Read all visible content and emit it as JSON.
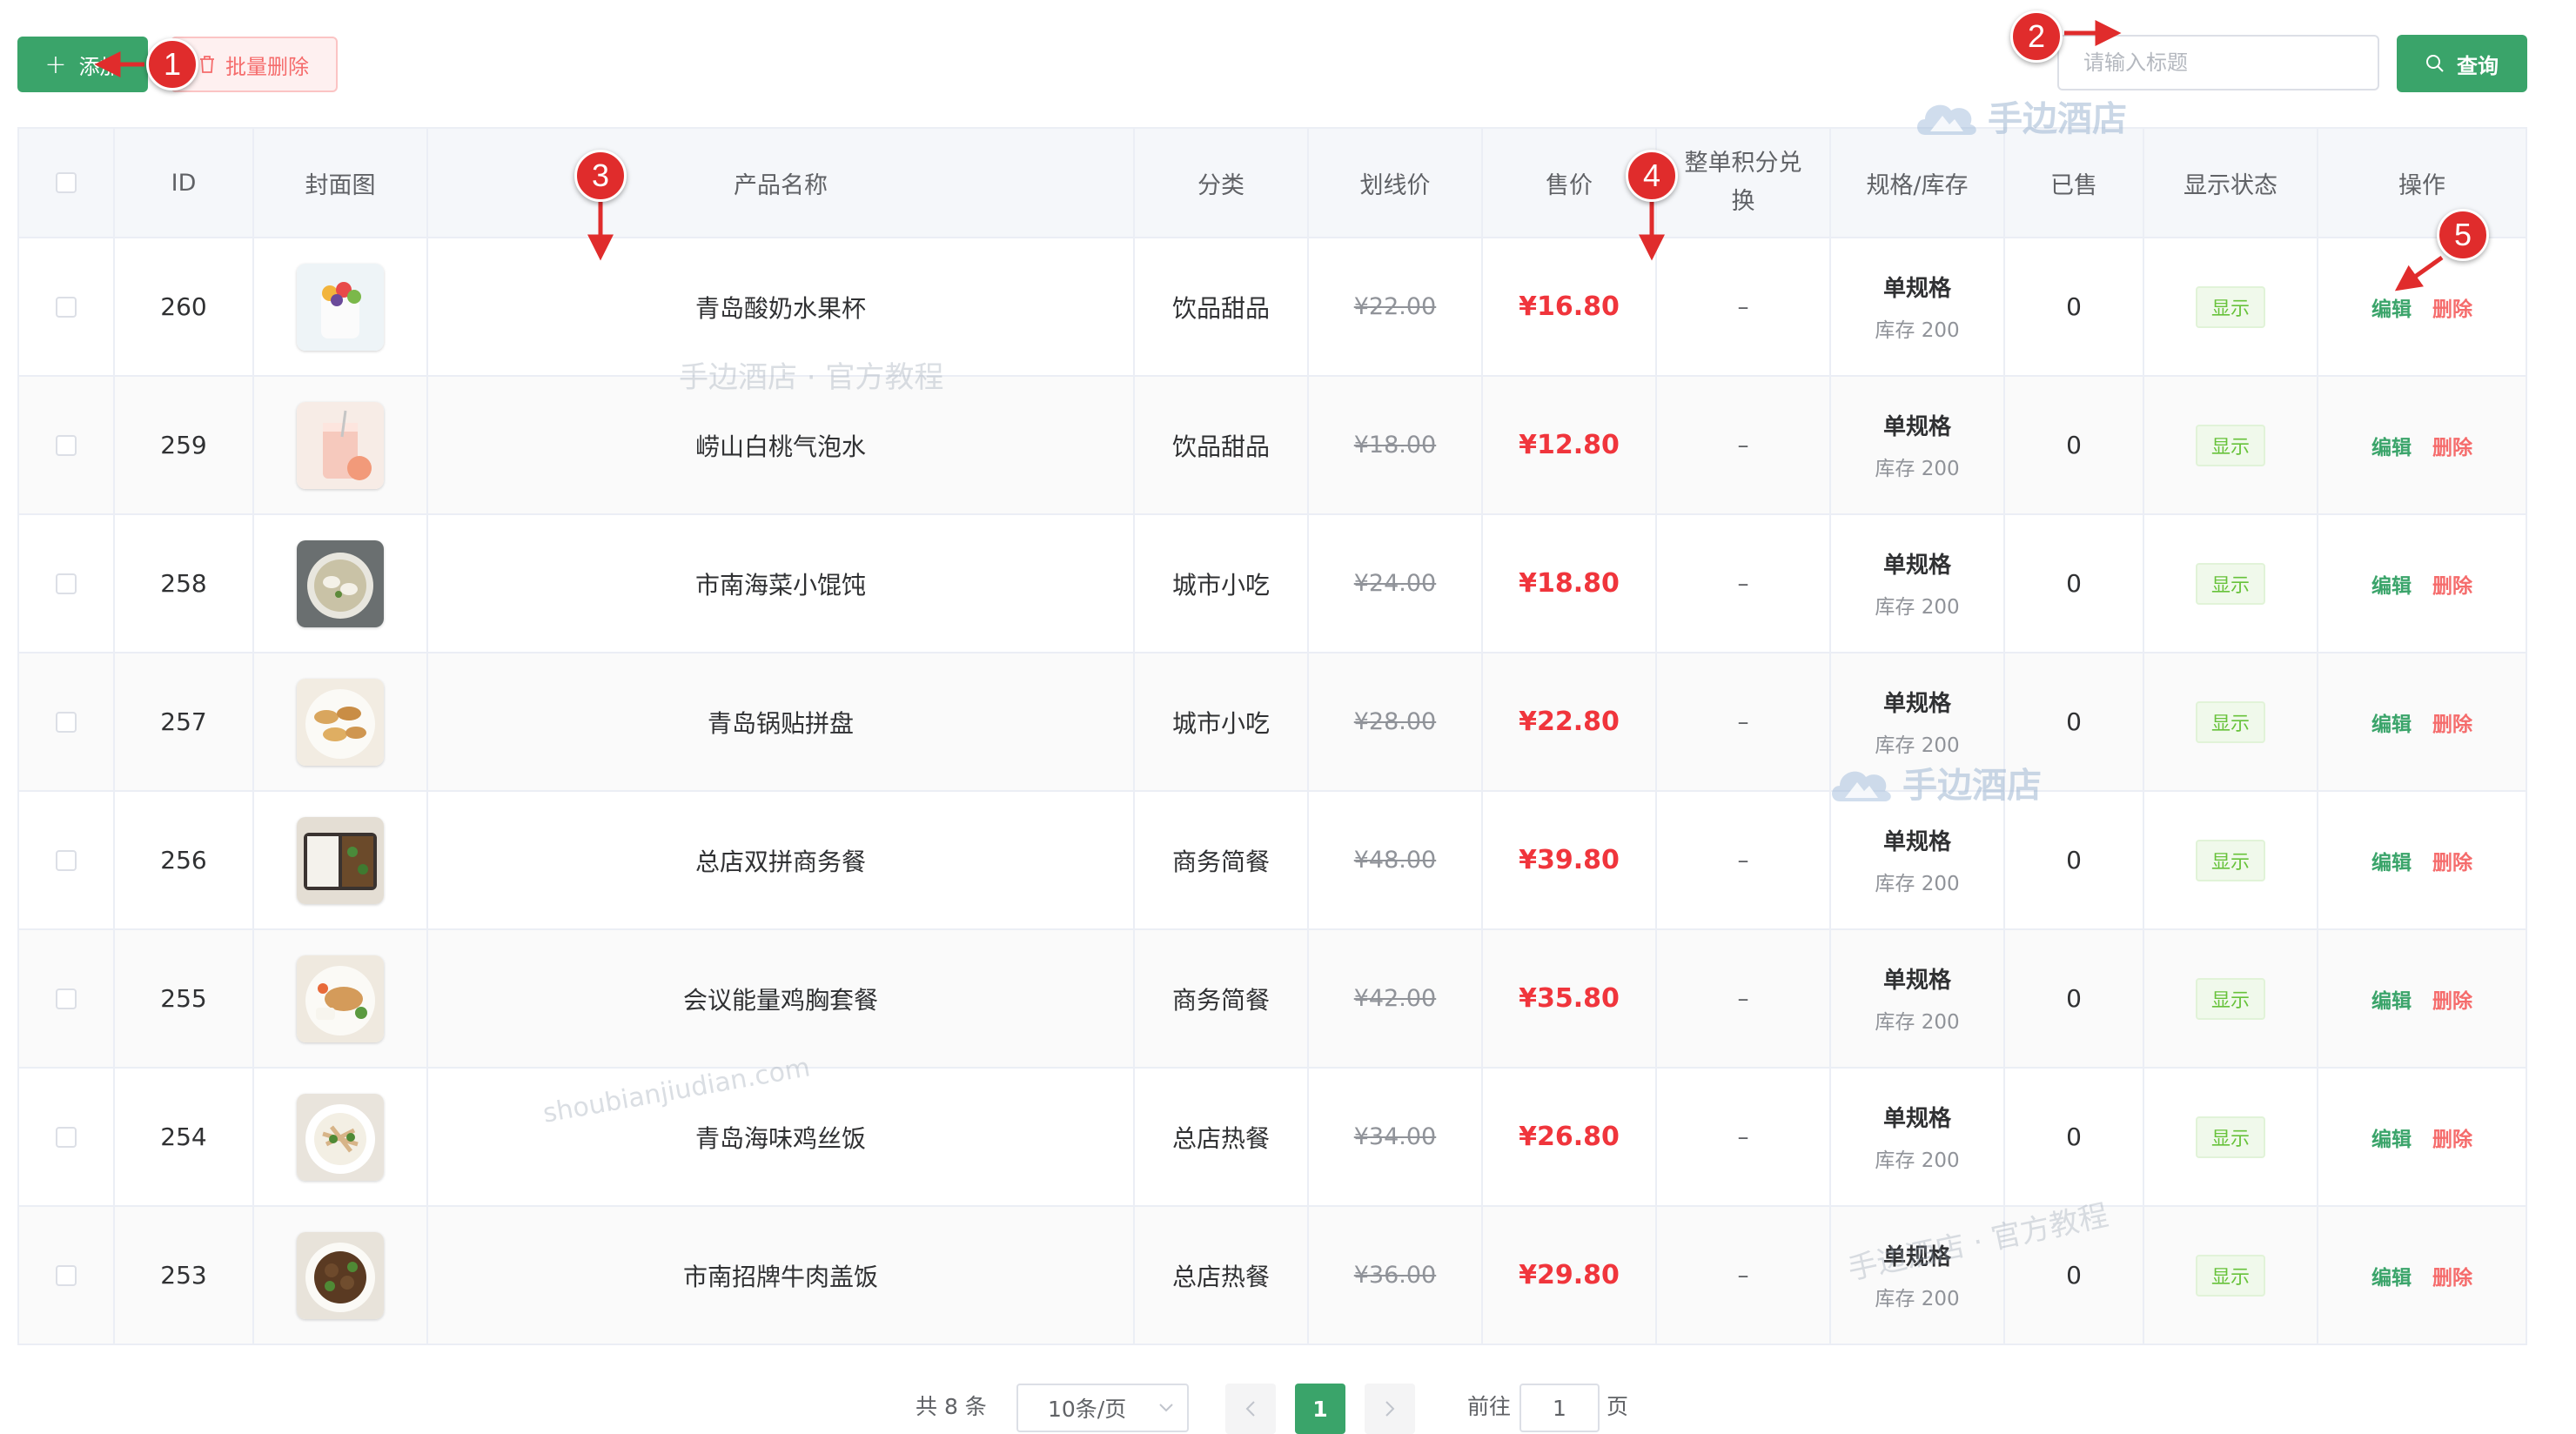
{
  "toolbar": {
    "add_label": "添加",
    "batch_delete_label": "批量删除",
    "search_placeholder": "请输入标题",
    "search_value": "",
    "query_label": "查询"
  },
  "table": {
    "headers": [
      "ID",
      "封面图",
      "产品名称",
      "分类",
      "划线价",
      "售价",
      "整单积分兑换",
      "规格/库存",
      "已售",
      "显示状态",
      "操作"
    ],
    "rows": [
      {
        "id": "260",
        "name": "青岛酸奶水果杯",
        "category": "饮品甜品",
        "orig_price": "¥22.00",
        "price": "¥16.80",
        "points": "–",
        "spec": "单规格",
        "stock": "库存 200",
        "sold": "0",
        "status": "显示",
        "edit": "编辑",
        "delete": "删除",
        "thumb_icon": "yogurt-fruit-cup"
      },
      {
        "id": "259",
        "name": "崂山白桃气泡水",
        "category": "饮品甜品",
        "orig_price": "¥18.00",
        "price": "¥12.80",
        "points": "–",
        "spec": "单规格",
        "stock": "库存 200",
        "sold": "0",
        "status": "显示",
        "edit": "编辑",
        "delete": "删除",
        "thumb_icon": "peach-sparkling-drink"
      },
      {
        "id": "258",
        "name": "市南海菜小馄饨",
        "category": "城市小吃",
        "orig_price": "¥24.00",
        "price": "¥18.80",
        "points": "–",
        "spec": "单规格",
        "stock": "库存 200",
        "sold": "0",
        "status": "显示",
        "edit": "编辑",
        "delete": "删除",
        "thumb_icon": "wonton-soup"
      },
      {
        "id": "257",
        "name": "青岛锅贴拼盘",
        "category": "城市小吃",
        "orig_price": "¥28.00",
        "price": "¥22.80",
        "points": "–",
        "spec": "单规格",
        "stock": "库存 200",
        "sold": "0",
        "status": "显示",
        "edit": "编辑",
        "delete": "删除",
        "thumb_icon": "potsticker-plate"
      },
      {
        "id": "256",
        "name": "总店双拼商务餐",
        "category": "商务简餐",
        "orig_price": "¥48.00",
        "price": "¥39.80",
        "points": "–",
        "spec": "单规格",
        "stock": "库存 200",
        "sold": "0",
        "status": "显示",
        "edit": "编辑",
        "delete": "删除",
        "thumb_icon": "bento-box"
      },
      {
        "id": "255",
        "name": "会议能量鸡胸套餐",
        "category": "商务简餐",
        "orig_price": "¥42.00",
        "price": "¥35.80",
        "points": "–",
        "spec": "单规格",
        "stock": "库存 200",
        "sold": "0",
        "status": "显示",
        "edit": "编辑",
        "delete": "删除",
        "thumb_icon": "chicken-breast-plate"
      },
      {
        "id": "254",
        "name": "青岛海味鸡丝饭",
        "category": "总店热餐",
        "orig_price": "¥34.00",
        "price": "¥26.80",
        "points": "–",
        "spec": "单规格",
        "stock": "库存 200",
        "sold": "0",
        "status": "显示",
        "edit": "编辑",
        "delete": "删除",
        "thumb_icon": "shredded-chicken-rice"
      },
      {
        "id": "253",
        "name": "市南招牌牛肉盖饭",
        "category": "总店热餐",
        "orig_price": "¥36.00",
        "price": "¥29.80",
        "points": "–",
        "spec": "单规格",
        "stock": "库存 200",
        "sold": "0",
        "status": "显示",
        "edit": "编辑",
        "delete": "删除",
        "thumb_icon": "beef-rice-bowl"
      }
    ]
  },
  "pagination": {
    "total": "共 8 条",
    "page_size": "10条/页",
    "current_page": "1",
    "goto_label": "前往",
    "goto_value": "1",
    "page_unit": "页"
  },
  "watermarks": {
    "brand": "手边酒店",
    "tutorial": "手边酒店 · 官方教程",
    "url": "shoubianjiudian.com"
  },
  "annotations": [
    "1",
    "2",
    "3",
    "4",
    "5"
  ],
  "colors": {
    "primary": "#3aa46a",
    "danger": "#f56c6c",
    "sale_price": "#f0353c",
    "annotation": "#e02c2c"
  }
}
